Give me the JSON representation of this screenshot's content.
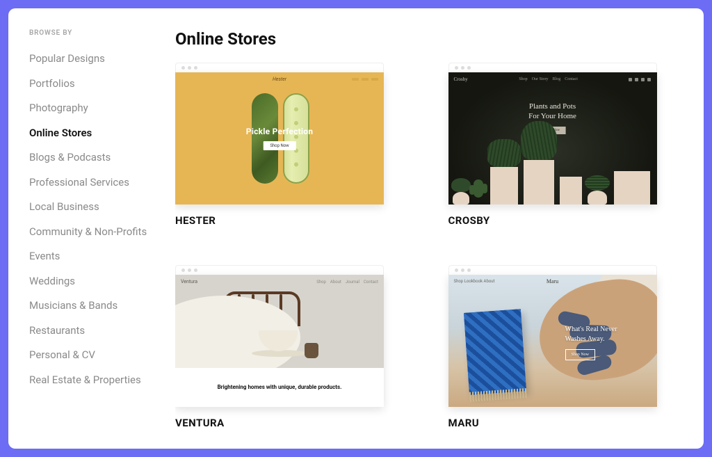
{
  "sidebar": {
    "title": "BROWSE BY",
    "items": [
      {
        "label": "Popular Designs",
        "active": false
      },
      {
        "label": "Portfolios",
        "active": false
      },
      {
        "label": "Photography",
        "active": false
      },
      {
        "label": "Online Stores",
        "active": true
      },
      {
        "label": "Blogs & Podcasts",
        "active": false
      },
      {
        "label": "Professional Services",
        "active": false
      },
      {
        "label": "Local Business",
        "active": false
      },
      {
        "label": "Community & Non-Profits",
        "active": false
      },
      {
        "label": "Events",
        "active": false
      },
      {
        "label": "Weddings",
        "active": false
      },
      {
        "label": "Musicians & Bands",
        "active": false
      },
      {
        "label": "Restaurants",
        "active": false
      },
      {
        "label": "Personal & CV",
        "active": false
      },
      {
        "label": "Real Estate & Properties",
        "active": false
      }
    ]
  },
  "main": {
    "title": "Online Stores"
  },
  "templates": [
    {
      "name": "HESTER",
      "brand": "Hester",
      "headline": "Pickle Perfection",
      "cta": "Shop Now"
    },
    {
      "name": "CROSBY",
      "brand": "Crosby",
      "menu": [
        "Shop",
        "Our Story",
        "Blog",
        "Contact"
      ],
      "headline1": "Plants and Pots",
      "headline2": "For Your Home",
      "cta": "Shop Now"
    },
    {
      "name": "VENTURA",
      "brand": "Ventura",
      "menu": [
        "Shop",
        "About",
        "Journal",
        "Contact"
      ],
      "tagline": "Brightening homes with unique, durable products."
    },
    {
      "name": "MARU",
      "brand": "Maru",
      "menu_left": [
        "Shop",
        "Lookbook",
        "About"
      ],
      "headline1": "What's Real Never",
      "headline2": "Washes Away.",
      "cta": "Shop Now"
    }
  ]
}
